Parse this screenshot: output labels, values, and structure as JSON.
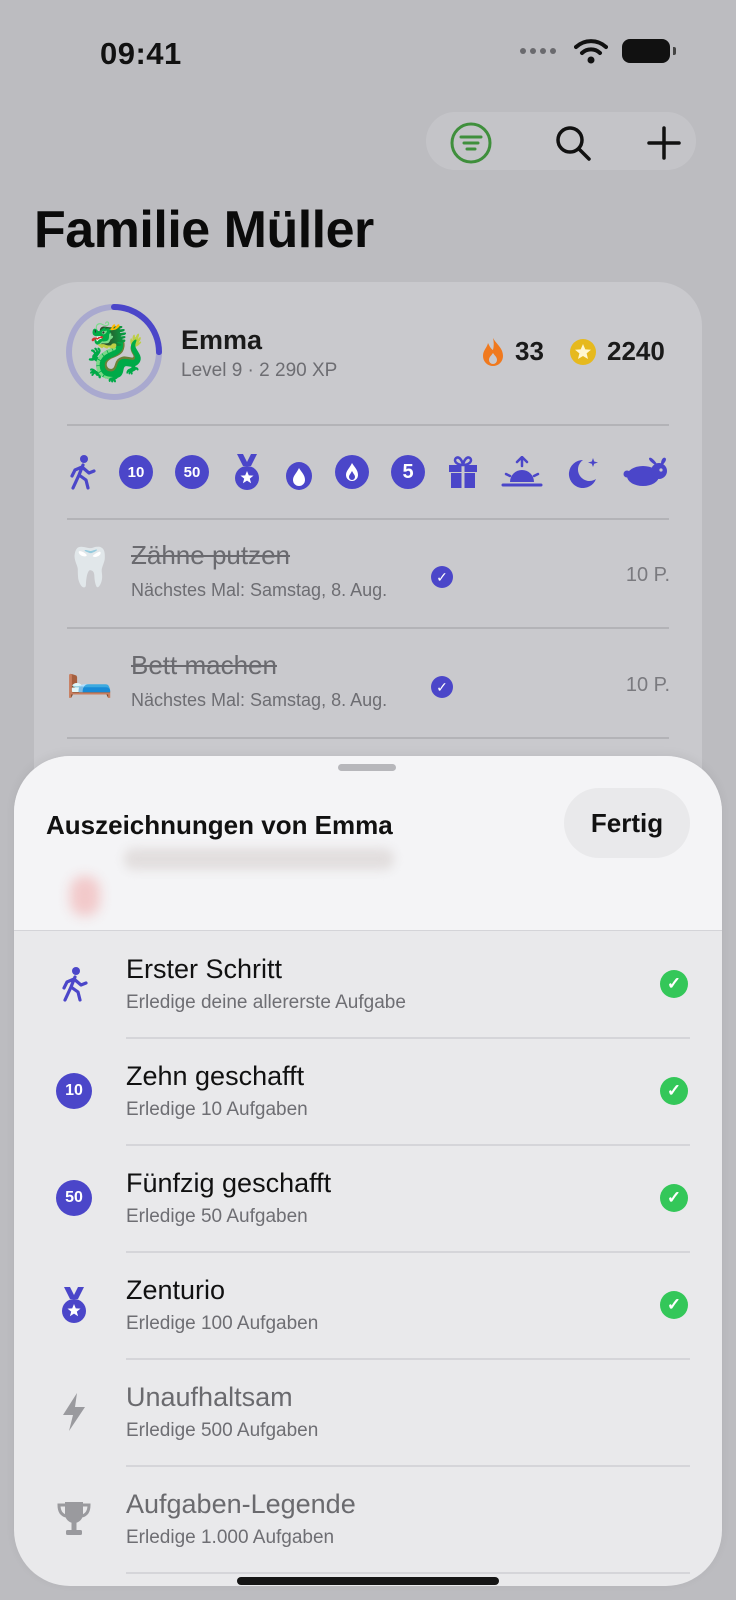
{
  "status_bar": {
    "time": "09:41"
  },
  "page": {
    "title": "Familie Müller"
  },
  "profile": {
    "name": "Emma",
    "level_text": "Level 9 · 2 290 XP",
    "streak": "33",
    "coins": "2240",
    "level_progress": 0.25,
    "avatar_emoji": "🐉"
  },
  "badges": [
    {
      "icon": "walking-figure-icon",
      "label": ""
    },
    {
      "icon": "number-badge",
      "label": "10"
    },
    {
      "icon": "number-badge",
      "label": "50"
    },
    {
      "icon": "medal-icon",
      "label": ""
    },
    {
      "icon": "flame-icon",
      "label": ""
    },
    {
      "icon": "flame-circle-icon",
      "label": ""
    },
    {
      "icon": "number-badge",
      "label": "5"
    },
    {
      "icon": "gift-icon",
      "label": ""
    },
    {
      "icon": "sunrise-icon",
      "label": ""
    },
    {
      "icon": "moon-stars-icon",
      "label": ""
    },
    {
      "icon": "hare-icon",
      "label": ""
    }
  ],
  "tasks": [
    {
      "emoji": "🦷",
      "title": "Zähne putzen",
      "subtitle": "Nächstes Mal: Samstag, 8. Aug.",
      "points": "10 P."
    },
    {
      "emoji": "🛏️",
      "title": "Bett machen",
      "subtitle": "Nächstes Mal: Samstag, 8. Aug.",
      "points": "10 P."
    }
  ],
  "sheet": {
    "title": "Auszeichnungen von Emma",
    "done_label": "Fertig",
    "achievements": [
      {
        "icon": "walking-figure-icon",
        "title": "Erster Schritt",
        "desc": "Erledige deine allererste Aufgabe",
        "earned": true
      },
      {
        "icon": "number-badge",
        "badge_text": "10",
        "title": "Zehn geschafft",
        "desc": "Erledige 10 Aufgaben",
        "earned": true
      },
      {
        "icon": "number-badge",
        "badge_text": "50",
        "title": "Fünfzig geschafft",
        "desc": "Erledige 50 Aufgaben",
        "earned": true
      },
      {
        "icon": "medal-icon",
        "title": "Zenturio",
        "desc": "Erledige 100 Aufgaben",
        "earned": true
      },
      {
        "icon": "lightning-icon",
        "title": "Unaufhaltsam",
        "desc": "Erledige 500 Aufgaben",
        "earned": false
      },
      {
        "icon": "trophy-icon",
        "title": "Aufgaben-Legende",
        "desc": "Erledige 1.000 Aufgaben",
        "earned": false
      }
    ]
  },
  "colors": {
    "accent": "#4b46c9",
    "success": "#34c759",
    "flame": "#f0791e",
    "coin": "#e6b91e",
    "filter_green": "#3f8f3c"
  }
}
